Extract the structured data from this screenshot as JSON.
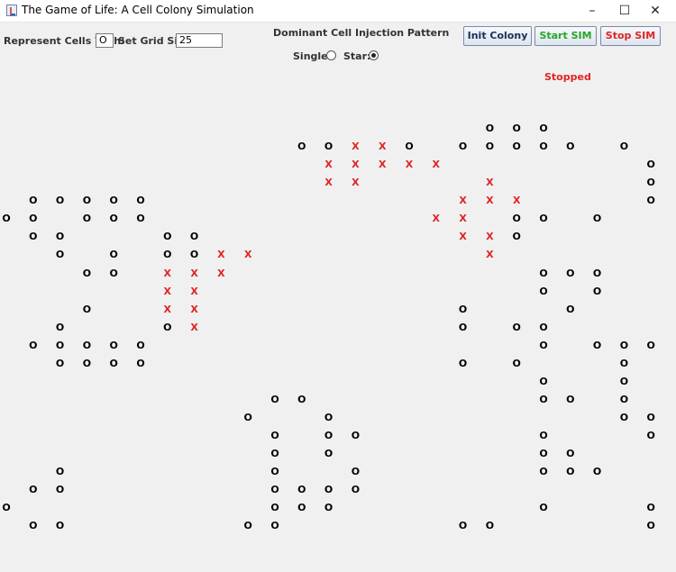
{
  "window": {
    "title": "The Game of Life: A Cell Colony Simulation",
    "minimize_glyph": "–",
    "maximize_glyph": "☐",
    "close_glyph": "✕"
  },
  "controls": {
    "represent_label": "Represent Cells With:",
    "represent_value": "O",
    "grid_size_label": "Set Grid Size:",
    "grid_size_value": "25",
    "pattern_heading": "Dominant Cell Injection Pattern",
    "single_label": "Single:",
    "star_label": "Star:",
    "selected_pattern": "star",
    "init_button": "Init Colony",
    "start_button": "Start SIM",
    "stop_button": "Stop SIM",
    "status": "Stopped"
  },
  "colors": {
    "start": "#2aa52a",
    "stop": "#e02424",
    "status": "#e02424",
    "dominant_cell": "#e02424",
    "normal_cell": "#000000"
  },
  "grid": {
    "size": 25,
    "rows": [
      ".........................",
      ".........................",
      "..................OOO....",
      "...........OOXXO.OOOOO.O.",
      "............XXXXX.......O",
      "............XX....X.....O",
      ".OOOOO...........XXX....O",
      "OO.OOO..........XX.OO.O..",
      ".OO...OO.........XXO.....",
      "..O.O.OOXX........X......",
      "...OO.XXX...........OOO..",
      "......XX............O.O..",
      "...O..XX.........O...O...",
      "..O...OX.........O.OO....",
      ".OOOOO..............O.OOO",
      "..OOOO...........O.O...O.",
      "....................O..O.",
      "..........OO........OO.O.",
      ".........O..O..........OO",
      "..........O.OO......O...O",
      "..........O.O.......OO...",
      "..O.......O..O......OOO..",
      ".OO.......OOOO...........",
      "O.........OOO.......O...O",
      ".OO......OO......OO.....O"
    ]
  }
}
